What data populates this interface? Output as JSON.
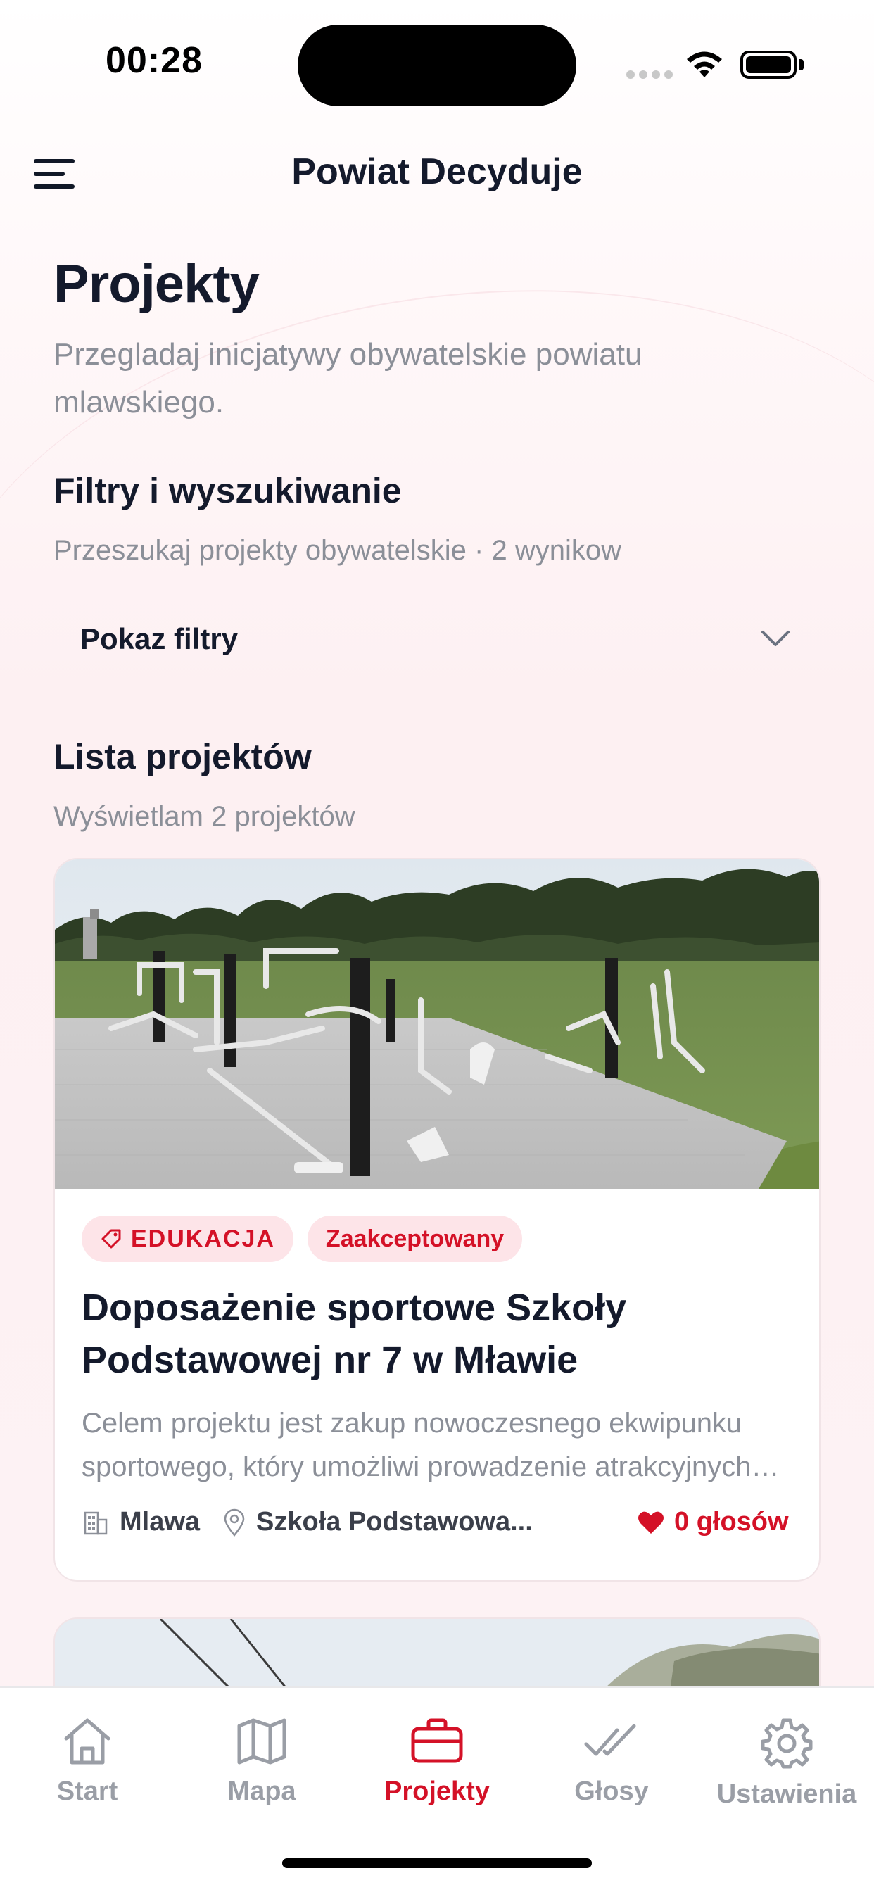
{
  "status_bar": {
    "time": "00:28"
  },
  "nav": {
    "title": "Powiat Decyduje"
  },
  "header": {
    "title": "Projekty",
    "subtitle": "Przegladaj inicjatywy obywatelskie powiatu mlawskiego."
  },
  "filters": {
    "title": "Filtry i wyszukiwanie",
    "subtitle": "Przeszukaj projekty obywatelskie · 2 wynikow",
    "toggle_label": "Pokaz filtry"
  },
  "list": {
    "title": "Lista projektów",
    "subtitle": "Wyświetlam 2 projektów"
  },
  "projects": [
    {
      "category": "EDUKACJA",
      "status": "Zaakceptowany",
      "title": "Doposażenie sportowe Szkoły Podstawowej nr 7 w Mławie",
      "description": "Celem projektu jest zakup nowoczesnego ekwipunku sportowego, który umożliwi prowadzenie atrakcyjnych zajęć",
      "city": "Mlawa",
      "location": "Szkoła Podstawowa...",
      "votes": "0 głosów"
    }
  ],
  "tabs": [
    {
      "label": "Start",
      "icon": "home-icon"
    },
    {
      "label": "Mapa",
      "icon": "map-icon"
    },
    {
      "label": "Projekty",
      "icon": "briefcase-icon",
      "active": true
    },
    {
      "label": "Głosy",
      "icon": "double-check-icon"
    },
    {
      "label": "Ustawienia",
      "icon": "gear-icon"
    }
  ],
  "colors": {
    "accent": "#d41127",
    "badge_bg": "#fde4e8",
    "text_primary": "#141a2c",
    "text_secondary": "#8b8f98"
  }
}
